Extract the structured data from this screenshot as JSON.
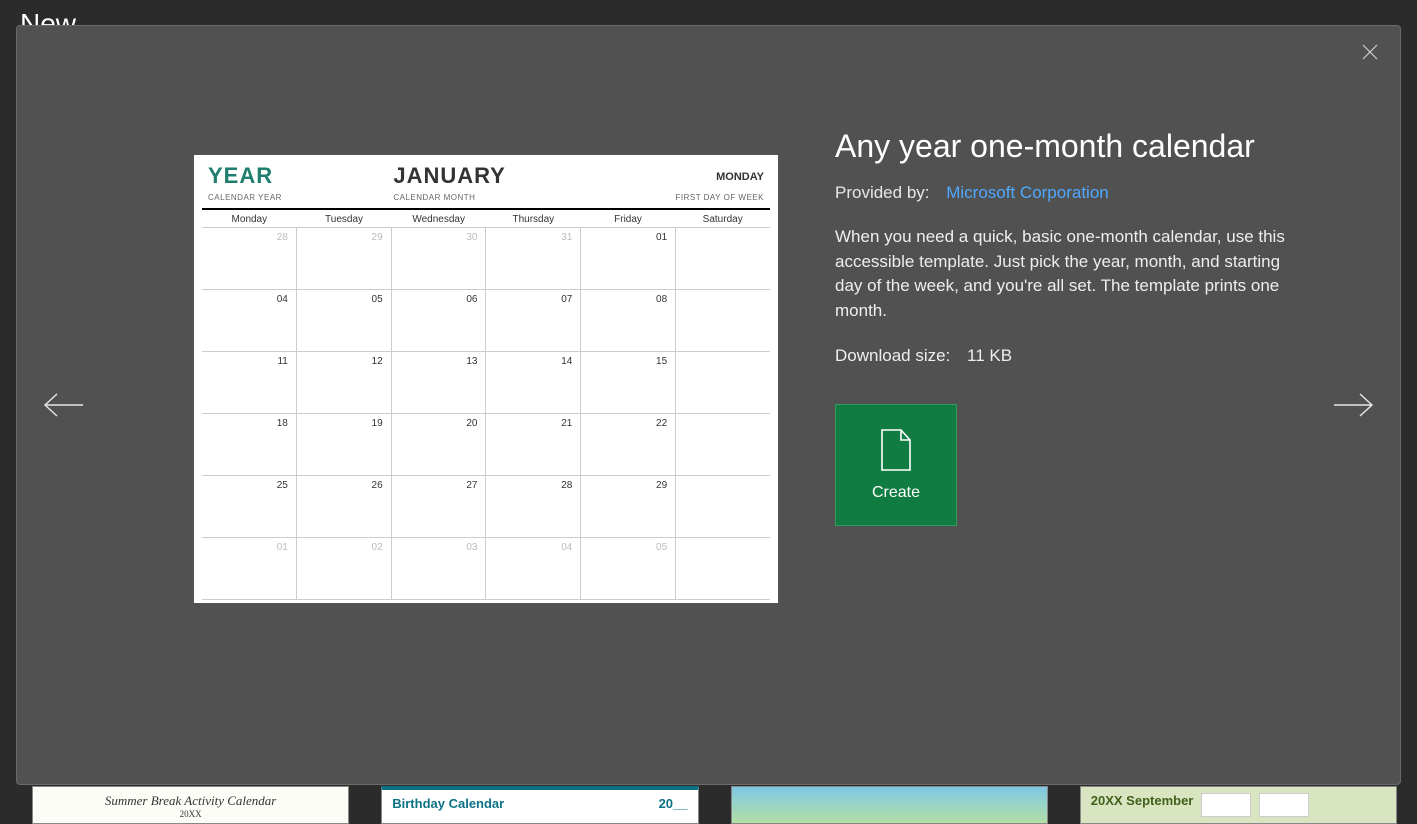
{
  "page": {
    "title": "New"
  },
  "dialog": {
    "title": "Any year one-month calendar",
    "provided_label": "Provided by:",
    "provider": "Microsoft Corporation",
    "description": "When you need a quick, basic one-month calendar, use this accessible template. Just pick the year, month, and starting day of the week, and you're all set. The template prints one month.",
    "download_label": "Download size:",
    "download_size": "11 KB",
    "create_label": "Create"
  },
  "preview": {
    "year_label": "YEAR",
    "month_label": "JANUARY",
    "firstday_value": "MONDAY",
    "sub_year": "CALENDAR YEAR",
    "sub_month": "CALENDAR MONTH",
    "sub_firstday": "FIRST DAY OF WEEK",
    "days": [
      "Monday",
      "Tuesday",
      "Wednesday",
      "Thursday",
      "Friday",
      "Saturday"
    ],
    "rows": [
      [
        {
          "v": "28",
          "dim": true
        },
        {
          "v": "29",
          "dim": true
        },
        {
          "v": "30",
          "dim": true
        },
        {
          "v": "31",
          "dim": true
        },
        {
          "v": "01"
        },
        {
          "v": ""
        }
      ],
      [
        {
          "v": "04"
        },
        {
          "v": "05"
        },
        {
          "v": "06"
        },
        {
          "v": "07"
        },
        {
          "v": "08"
        },
        {
          "v": ""
        }
      ],
      [
        {
          "v": "11"
        },
        {
          "v": "12"
        },
        {
          "v": "13"
        },
        {
          "v": "14"
        },
        {
          "v": "15"
        },
        {
          "v": ""
        }
      ],
      [
        {
          "v": "18"
        },
        {
          "v": "19"
        },
        {
          "v": "20"
        },
        {
          "v": "21"
        },
        {
          "v": "22"
        },
        {
          "v": ""
        }
      ],
      [
        {
          "v": "25"
        },
        {
          "v": "26"
        },
        {
          "v": "27"
        },
        {
          "v": "28"
        },
        {
          "v": "29"
        },
        {
          "v": ""
        }
      ],
      [
        {
          "v": "01",
          "dim": true
        },
        {
          "v": "02",
          "dim": true
        },
        {
          "v": "03",
          "dim": true
        },
        {
          "v": "04",
          "dim": true
        },
        {
          "v": "05",
          "dim": true
        },
        {
          "v": ""
        }
      ]
    ]
  },
  "thumbs": {
    "t1_title": "Summer Break Activity Calendar",
    "t1_sub": "20XX",
    "t2_title": "Birthday Calendar",
    "t2_year": "20__",
    "t4_title": "20XX September"
  }
}
